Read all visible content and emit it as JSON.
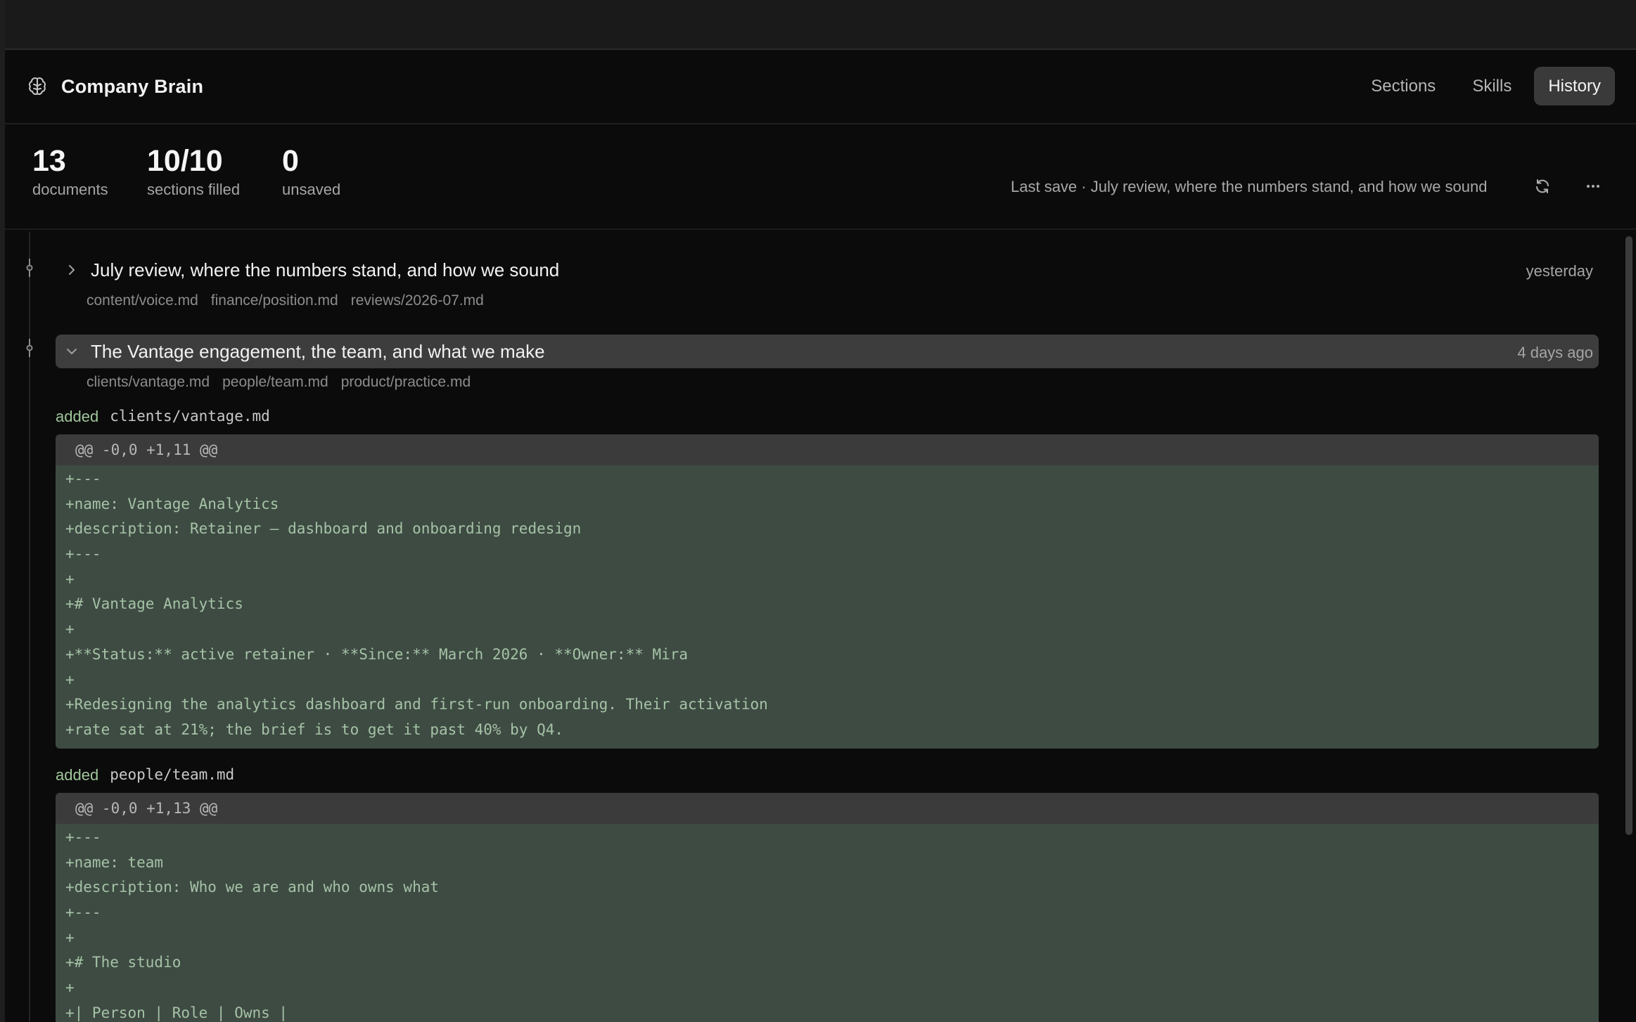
{
  "app": {
    "title": "Company Brain",
    "icon": "brain-icon"
  },
  "nav": {
    "items": [
      {
        "label": "Sections",
        "active": false
      },
      {
        "label": "Skills",
        "active": false
      },
      {
        "label": "History",
        "active": true
      }
    ]
  },
  "stats": [
    {
      "value": "13",
      "label": "documents"
    },
    {
      "value": "10/10",
      "label": "sections filled"
    },
    {
      "value": "0",
      "label": "unsaved"
    }
  ],
  "last_save": "Last save · July review, where the numbers stand, and how we sound",
  "actions": {
    "refresh_icon": "refresh-icon",
    "more_icon": "more-horizontal-icon"
  },
  "commits": [
    {
      "title": "July review, where the numbers stand, and how we sound",
      "time": "yesterday",
      "expanded": false,
      "files": [
        "content/voice.md",
        "finance/position.md",
        "reviews/2026-07.md"
      ]
    },
    {
      "title": "The Vantage engagement, the team, and what we make",
      "time": "4 days ago",
      "expanded": true,
      "files": [
        "clients/vantage.md",
        "people/team.md",
        "product/practice.md"
      ],
      "changes": [
        {
          "kind": "added",
          "file": "clients/vantage.md",
          "hunk": "@@ -0,0 +1,11 @@",
          "lines": [
            "+---",
            "+name: Vantage Analytics",
            "+description: Retainer — dashboard and onboarding redesign",
            "+---",
            "+",
            "+# Vantage Analytics",
            "+",
            "+**Status:** active retainer · **Since:** March 2026 · **Owner:** Mira",
            "+",
            "+Redesigning the analytics dashboard and first-run onboarding. Their activation",
            "+rate sat at 21%; the brief is to get it past 40% by Q4."
          ]
        },
        {
          "kind": "added",
          "file": "people/team.md",
          "hunk": "@@ -0,0 +1,13 @@",
          "lines": [
            "+---",
            "+name: team",
            "+description: Who we are and who owns what",
            "+---",
            "+",
            "+# The studio",
            "+",
            "+| Person | Role | Owns |"
          ]
        }
      ]
    }
  ],
  "colors": {
    "background": "#0b0b0b",
    "added_text": "#9fc79a",
    "diff_background": "#3e4b43",
    "active_nav": "#3a3a3a"
  }
}
